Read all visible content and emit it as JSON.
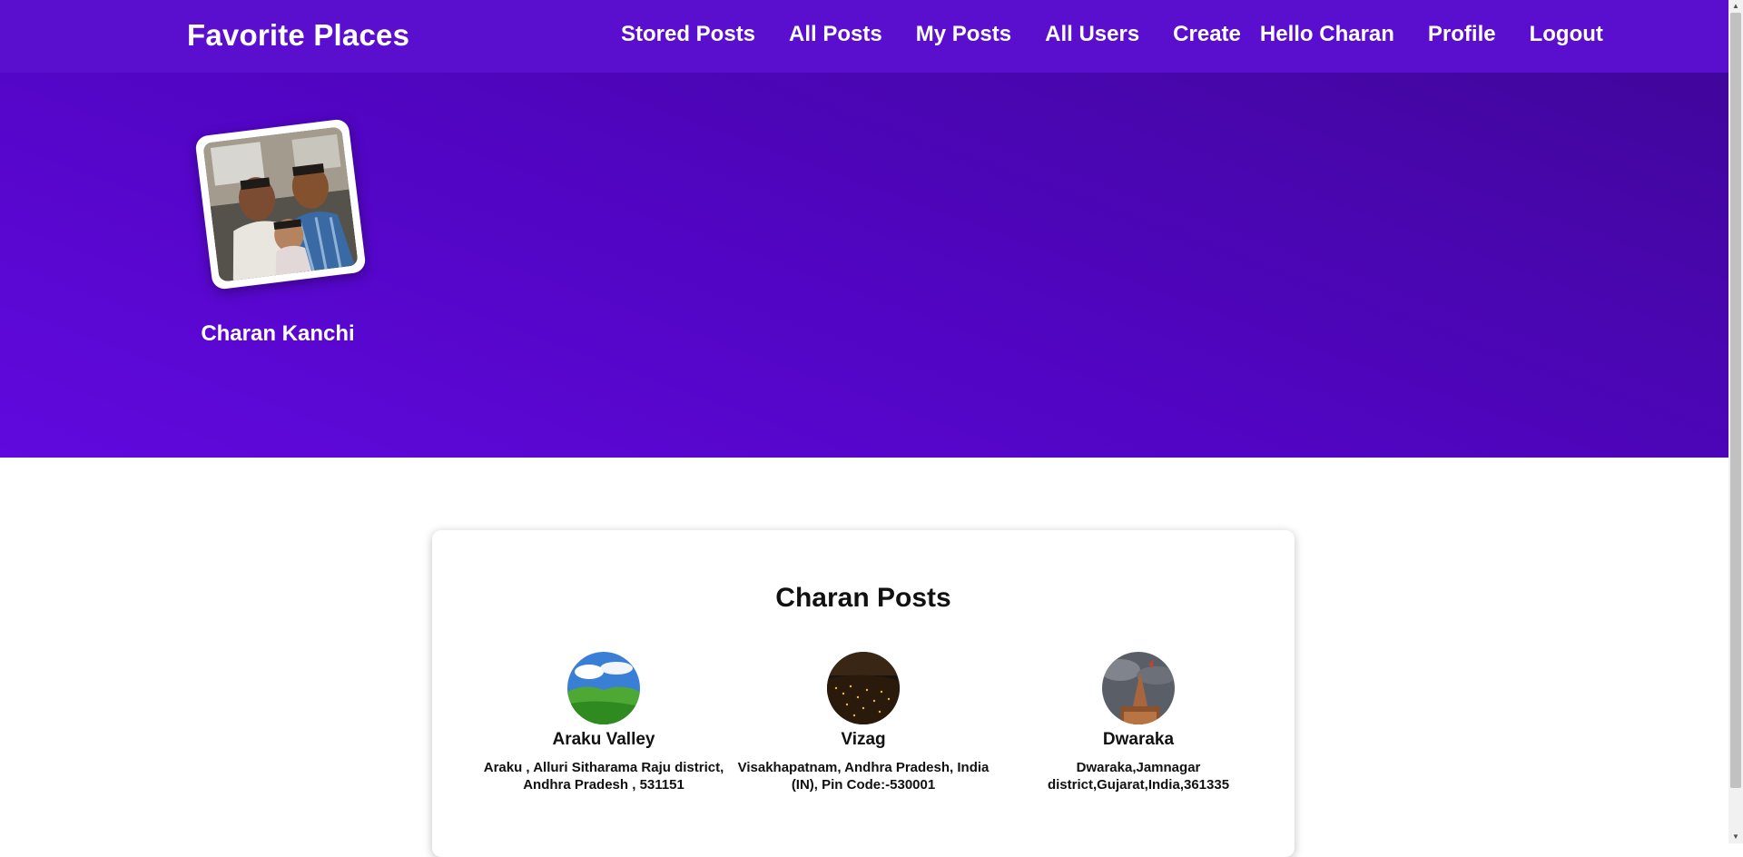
{
  "brand": "Favorite Places",
  "nav": {
    "stored_posts": "Stored Posts",
    "all_posts": "All Posts",
    "my_posts": "My Posts",
    "all_users": "All Users",
    "create": "Create",
    "greeting": "Hello Charan",
    "profile": "Profile",
    "logout": "Logout"
  },
  "profile": {
    "name": "Charan Kanchi"
  },
  "posts_section": {
    "title": "Charan Posts",
    "posts": [
      {
        "name": "Araku Valley",
        "address": "Araku , Alluri Sitharama Raju district, Andhra Pradesh , 531151"
      },
      {
        "name": "Vizag",
        "address": "Visakhapatnam, Andhra Pradesh, India (IN), Pin Code:-530001"
      },
      {
        "name": "Dwaraka",
        "address": "Dwaraka,Jamnagar district,Gujarat,India,361335"
      }
    ]
  },
  "colors": {
    "navbar": "#5a0fce",
    "hero_gradient": [
      "#41069c",
      "#6109de"
    ],
    "text_light": "#ffffff",
    "text_dark": "#111111"
  }
}
